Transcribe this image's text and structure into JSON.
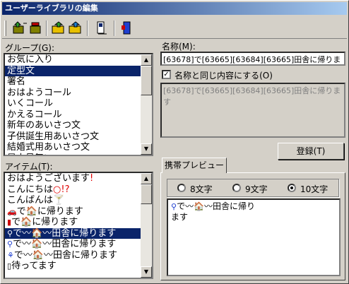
{
  "window": {
    "title": "ユーザーライブラリの編集"
  },
  "group_label": "グループ(G):",
  "groups": [
    {
      "label": "お気に入り",
      "selected": false
    },
    {
      "label": "定型文",
      "selected": true
    },
    {
      "label": "署名",
      "selected": false
    },
    {
      "label": "おはようコール",
      "selected": false
    },
    {
      "label": "いくコール",
      "selected": false
    },
    {
      "label": "かえるコール",
      "selected": false
    },
    {
      "label": "新年のあいさつ文",
      "selected": false
    },
    {
      "label": "子供誕生用あいさつ文",
      "selected": false
    },
    {
      "label": "結婚式用あいさつ文",
      "selected": false
    },
    {
      "label": "暑中見舞い",
      "selected": false
    }
  ],
  "item_label": "アイテム(T):",
  "items": [
    {
      "text": "おはようございます",
      "suffix": "!"
    },
    {
      "text": "こんにちは",
      "suffix": "○!?"
    },
    {
      "text": "こんばんは",
      "suffix": "🍸"
    },
    {
      "text": "で🏠に帰ります",
      "prefix": "car"
    },
    {
      "text": "で🏠に帰ります",
      "prefix": "bus"
    },
    {
      "text": "で〰🏠〰田舎に帰ります",
      "prefix": "bike",
      "selected": true
    },
    {
      "text": "で〰🏠〰田舎に帰ります",
      "prefix": "bike2"
    },
    {
      "text": "で〰🏠〰田舎に帰ります",
      "prefix": "walk"
    },
    {
      "text": "待ってます",
      "prefix": "phone"
    }
  ],
  "name_label": "名称(M):",
  "name_value": "[63678]で[63665][63684][63665]田舎に帰りま",
  "same_as_name_label": "名称と同じ内容にする(O)",
  "same_as_name_checked": true,
  "content_value": "[63678]で[63665][63684][63665]田舎に帰ります",
  "register_button": "登録(T)",
  "preview_tab": "携帯プレビュー",
  "preview_options": [
    {
      "label": "8文字",
      "checked": false
    },
    {
      "label": "9文字",
      "checked": false
    },
    {
      "label": "10文字",
      "checked": true
    }
  ],
  "preview_line1": "で〰🏠〰田舎に帰り",
  "preview_line2": "ます",
  "colors": {
    "selection": "#0a246a",
    "titlebar": "#0a246a",
    "red": "#e00000",
    "green": "#2aa02a",
    "blue": "#1f3fd0"
  }
}
